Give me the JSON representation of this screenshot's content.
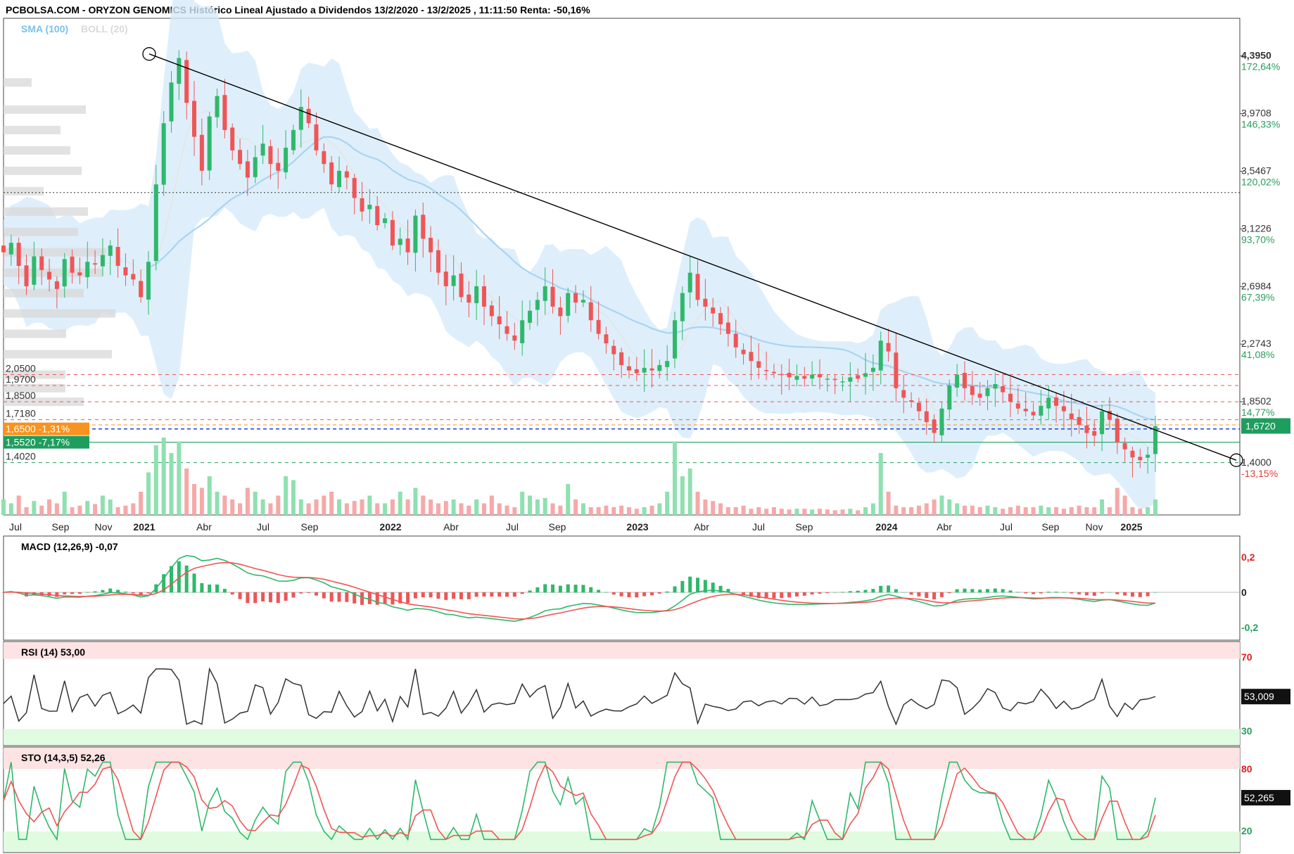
{
  "header": {
    "title": "PCBOLSA.COM - ORYZON GENOMICS Histórico Lineal Ajustado a Dividendos 13/2/2020 - 13/2/2025 , 11:11:50 Renta: -50,16%"
  },
  "legend": {
    "sma": "SMA (100)",
    "boll": "BOLL (20)"
  },
  "colors": {
    "up": "#2fb86b",
    "down": "#f05555",
    "band": "#d6ebfa",
    "sma": "#a9d4f2",
    "grid": "#e5e5e5",
    "red_dash": "#f05555",
    "green_level": "#1f9d5e",
    "blue_dash": "#2040d0",
    "pct_green": "#2a9d5f",
    "pct_red": "#e53b3b",
    "rsi_top": "#fde3e3",
    "rsi_bottom": "#e0fbe0"
  },
  "chart_data": [
    {
      "type": "candlestick",
      "title": "ORYZON GENOMICS",
      "x_labels": [
        "Jul",
        "Sep",
        "Nov",
        "2021",
        "Abr",
        "Jul",
        "Sep",
        "2022",
        "Abr",
        "Jul",
        "Sep",
        "2023",
        "Abr",
        "Jul",
        "Sep",
        "2024",
        "Abr",
        "Jul",
        "Sep",
        "Nov",
        "2025"
      ],
      "x_labels_bold": [
        "2021",
        "2022",
        "2023",
        "2024",
        "2025"
      ],
      "y_ticks": [
        {
          "price": "4,3950",
          "pct": "172,64%"
        },
        {
          "price": "3,9708",
          "pct": "146,33%"
        },
        {
          "price": "3,5467",
          "pct": "120,02%"
        },
        {
          "price": "3,1226",
          "pct": "93,70%"
        },
        {
          "price": "2,6984",
          "pct": "67,39%"
        },
        {
          "price": "2,2743",
          "pct": "41,08%"
        },
        {
          "price": "1,8502",
          "pct": "14,77%"
        },
        {
          "price": "1,4000",
          "pct": "-13,15%"
        }
      ],
      "y_range": [
        1.25,
        4.6
      ],
      "current_price": "1,6720",
      "reference_line": 3.39,
      "levels_left": [
        {
          "value": "2,0500",
          "style": "red-dash"
        },
        {
          "value": "1,9700",
          "style": "red-dash"
        },
        {
          "value": "1,8500",
          "style": "red-dash"
        },
        {
          "value": "1,7180",
          "style": "red-dash"
        },
        {
          "value": "1,4020",
          "style": "green-dash"
        }
      ],
      "badges": [
        {
          "value": "1,6500",
          "pct": "-1,31%",
          "color": "#f7931e"
        },
        {
          "value": "1,5520",
          "pct": "-7,17%",
          "color": "#1f9d5e"
        }
      ],
      "trendline": {
        "from": {
          "date": "2020-12",
          "price": 4.41
        },
        "to": {
          "date": "2025-03",
          "price": 1.42
        }
      },
      "series_note": "weekly candles, price in EUR",
      "closes": [
        2.95,
        3.02,
        2.85,
        2.7,
        2.92,
        2.82,
        2.75,
        2.68,
        2.9,
        2.8,
        2.78,
        2.88,
        2.86,
        2.93,
        3.0,
        2.85,
        2.78,
        2.75,
        2.62,
        2.88,
        3.45,
        3.9,
        4.2,
        4.38,
        4.05,
        3.8,
        3.55,
        3.95,
        4.1,
        3.85,
        3.7,
        3.6,
        3.5,
        3.65,
        3.75,
        3.6,
        3.55,
        3.72,
        3.85,
        4.02,
        3.9,
        3.7,
        3.6,
        3.45,
        3.55,
        3.5,
        3.35,
        3.25,
        3.3,
        3.15,
        3.2,
        3.0,
        3.05,
        2.95,
        3.22,
        3.05,
        2.95,
        2.8,
        2.7,
        2.78,
        2.62,
        2.58,
        2.7,
        2.55,
        2.48,
        2.42,
        2.35,
        2.3,
        2.45,
        2.52,
        2.6,
        2.7,
        2.55,
        2.48,
        2.65,
        2.58,
        2.6,
        2.45,
        2.35,
        2.28,
        2.2,
        2.12,
        2.08,
        2.06,
        2.1,
        2.08,
        2.12,
        2.15,
        2.45,
        2.65,
        2.8,
        2.6,
        2.55,
        2.5,
        2.42,
        2.35,
        2.25,
        2.2,
        2.15,
        2.1,
        2.08,
        2.06,
        2.05,
        2.03,
        2.04,
        2.02,
        2.05,
        2.03,
        2.02,
        2.01,
        2.0,
        2.03,
        2.02,
        2.06,
        2.1,
        2.3,
        2.22,
        1.95,
        1.88,
        1.85,
        1.78,
        1.7,
        1.62,
        1.8,
        1.97,
        2.05,
        1.95,
        1.9,
        1.88,
        1.95,
        1.98,
        1.92,
        1.85,
        1.8,
        1.78,
        1.75,
        1.82,
        1.88,
        1.82,
        1.78,
        1.72,
        1.68,
        1.62,
        1.6,
        1.78,
        1.72,
        1.55,
        1.5,
        1.44,
        1.42,
        1.46,
        1.67
      ],
      "volumes": [
        0.2,
        0.15,
        0.25,
        0.1,
        0.18,
        0.12,
        0.2,
        0.15,
        0.3,
        0.1,
        0.12,
        0.18,
        0.14,
        0.25,
        0.2,
        0.1,
        0.12,
        0.15,
        0.3,
        0.55,
        0.9,
        1.0,
        0.8,
        0.95,
        0.6,
        0.4,
        0.35,
        0.5,
        0.3,
        0.25,
        0.2,
        0.15,
        0.35,
        0.3,
        0.2,
        0.15,
        0.25,
        0.5,
        0.45,
        0.2,
        0.15,
        0.2,
        0.25,
        0.3,
        0.2,
        0.15,
        0.18,
        0.2,
        0.25,
        0.15,
        0.15,
        0.2,
        0.3,
        0.2,
        0.35,
        0.25,
        0.2,
        0.15,
        0.18,
        0.2,
        0.15,
        0.12,
        0.2,
        0.15,
        0.25,
        0.15,
        0.12,
        0.1,
        0.3,
        0.25,
        0.2,
        0.22,
        0.15,
        0.12,
        0.4,
        0.2,
        0.15,
        0.1,
        0.1,
        0.12,
        0.1,
        0.12,
        0.1,
        0.08,
        0.1,
        0.12,
        0.15,
        0.3,
        0.95,
        0.5,
        0.6,
        0.3,
        0.2,
        0.18,
        0.15,
        0.1,
        0.1,
        0.12,
        0.08,
        0.1,
        0.08,
        0.1,
        0.08,
        0.07,
        0.08,
        0.08,
        0.07,
        0.08,
        0.07,
        0.06,
        0.07,
        0.08,
        0.06,
        0.1,
        0.15,
        0.8,
        0.3,
        0.12,
        0.1,
        0.1,
        0.12,
        0.15,
        0.2,
        0.25,
        0.2,
        0.15,
        0.12,
        0.12,
        0.1,
        0.12,
        0.1,
        0.08,
        0.1,
        0.12,
        0.1,
        0.1,
        0.12,
        0.1,
        0.1,
        0.08,
        0.1,
        0.12,
        0.1,
        0.1,
        0.2,
        0.1,
        0.35,
        0.25,
        0.1,
        0.08,
        0.1,
        0.2
      ]
    },
    {
      "type": "line",
      "title": "MACD (12,26,9)",
      "value": "-0,07",
      "y_ticks": [
        "0,2",
        "0",
        "-0,2"
      ]
    },
    {
      "type": "line",
      "title": "RSI (14)",
      "value": "53,00",
      "current": "53,009",
      "y_ticks": [
        "70",
        "30"
      ]
    },
    {
      "type": "line",
      "title": "STO (14,3,5)",
      "value": "52,26",
      "current": "52,265",
      "y_ticks": [
        "80",
        "20"
      ]
    }
  ]
}
